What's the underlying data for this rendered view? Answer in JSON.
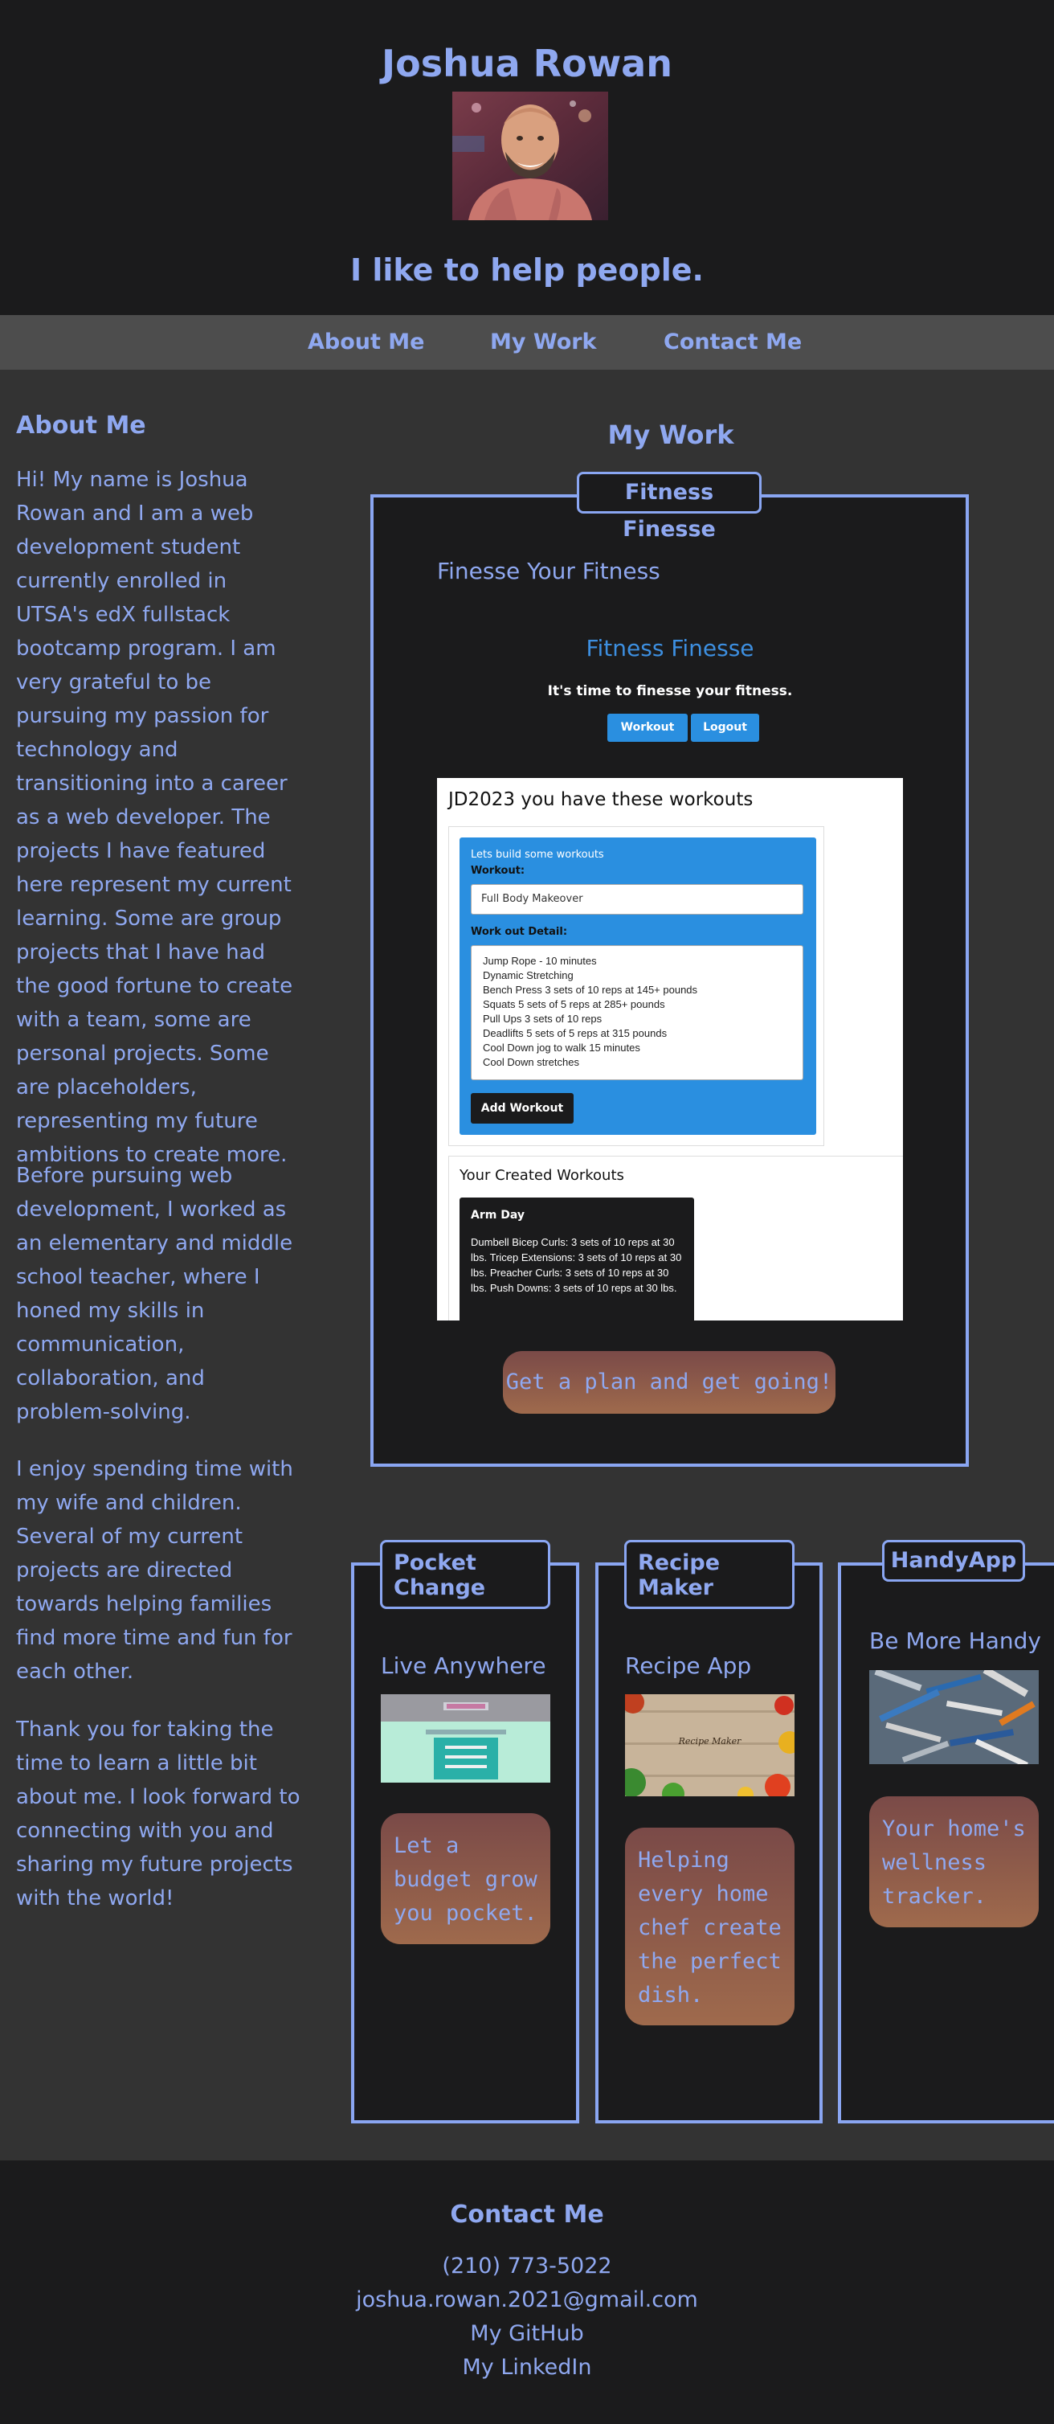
{
  "header": {
    "name": "Joshua Rowan",
    "tagline": "I like to help people."
  },
  "nav": {
    "items": [
      "About Me",
      "My Work",
      "Contact Me"
    ]
  },
  "about": {
    "heading": "About Me",
    "paragraphs": [
      "Hi! My name is Joshua Rowan and I am a web development student currently enrolled in UTSA's edX fullstack bootcamp program. I am very grateful to be pursuing my passion for technology and transitioning into a career as a web developer. The projects I have featured here represent my current learning. Some are group projects that I have had the good fortune to create with a team, some are personal projects. Some are placeholders, representing my future ambitions to create more.",
      "Before pursuing web development, I worked as an elementary and middle school teacher, where I honed my skills in communication, collaboration, and problem-solving.",
      "I enjoy spending time with my wife and children. Several of my current projects are directed towards helping families find more time and fun for each other.",
      "Thank you for taking the time to learn a little bit about me. I look forward to connecting with you and sharing my future projects with the world!"
    ]
  },
  "work": {
    "heading": "My Work",
    "featured": {
      "tag": "Fitness Finesse",
      "subtitle": "Finesse Your Fitness",
      "cta": "Get a plan and get going!",
      "screenshot": {
        "app_title": "Fitness Finesse",
        "app_subtitle": "It's time to finesse your fitness.",
        "buttons": [
          "Workout",
          "Logout"
        ],
        "workouts_heading": "JD2023 you have these workouts",
        "form_intro": "Lets build some workouts",
        "workout_label": "Workout:",
        "workout_value": "Full Body Makeover",
        "detail_label": "Work out Detail:",
        "detail_lines": [
          "Jump Rope - 10 minutes",
          "Dynamic Stretching",
          "Bench Press 3 sets of 10 reps at 145+ pounds",
          "Squats 5 sets of 5 reps at 285+ pounds",
          "Pull Ups 3 sets of 10 reps",
          "Deadlifts 5 sets of 5 reps at 315 pounds",
          "Cool Down jog to walk 15 minutes",
          "Cool Down stretches"
        ],
        "add_button": "Add Workout",
        "created_heading": "Your Created Workouts",
        "card_title": "Arm Day",
        "card_body": "Dumbell Bicep Curls: 3 sets of 10 reps at 30 lbs. Tricep Extensions: 3 sets of 10 reps at 30 lbs. Preacher Curls: 3 sets of 10 reps at 30 lbs. Push Downs: 3 sets of 10 reps at 30 lbs."
      }
    },
    "projects": [
      {
        "tag": "Pocket Change",
        "subtitle": "Live Anywhere",
        "cta": "Let a budget grow you pocket."
      },
      {
        "tag": "Recipe Maker",
        "subtitle": "Recipe App",
        "cta": "Helping every home chef create the perfect dish.",
        "image_text": "Recipe Maker"
      },
      {
        "tag": "HandyApp",
        "subtitle": "Be More Handy",
        "cta": "Your home's wellness tracker."
      }
    ]
  },
  "contact": {
    "heading": "Contact Me",
    "phone": "(210) 773-5022",
    "email": "joshua.rowan.2021@gmail.com",
    "github": "My GitHub",
    "linkedin": "My LinkedIn"
  },
  "colors": {
    "accent": "#8fa8f0",
    "header_bg": "#1b1b1c",
    "body_bg": "#333333",
    "nav_bg": "#4d4d4d",
    "cta_gradient": [
      "#7a4a48",
      "#9f6a4c"
    ]
  }
}
